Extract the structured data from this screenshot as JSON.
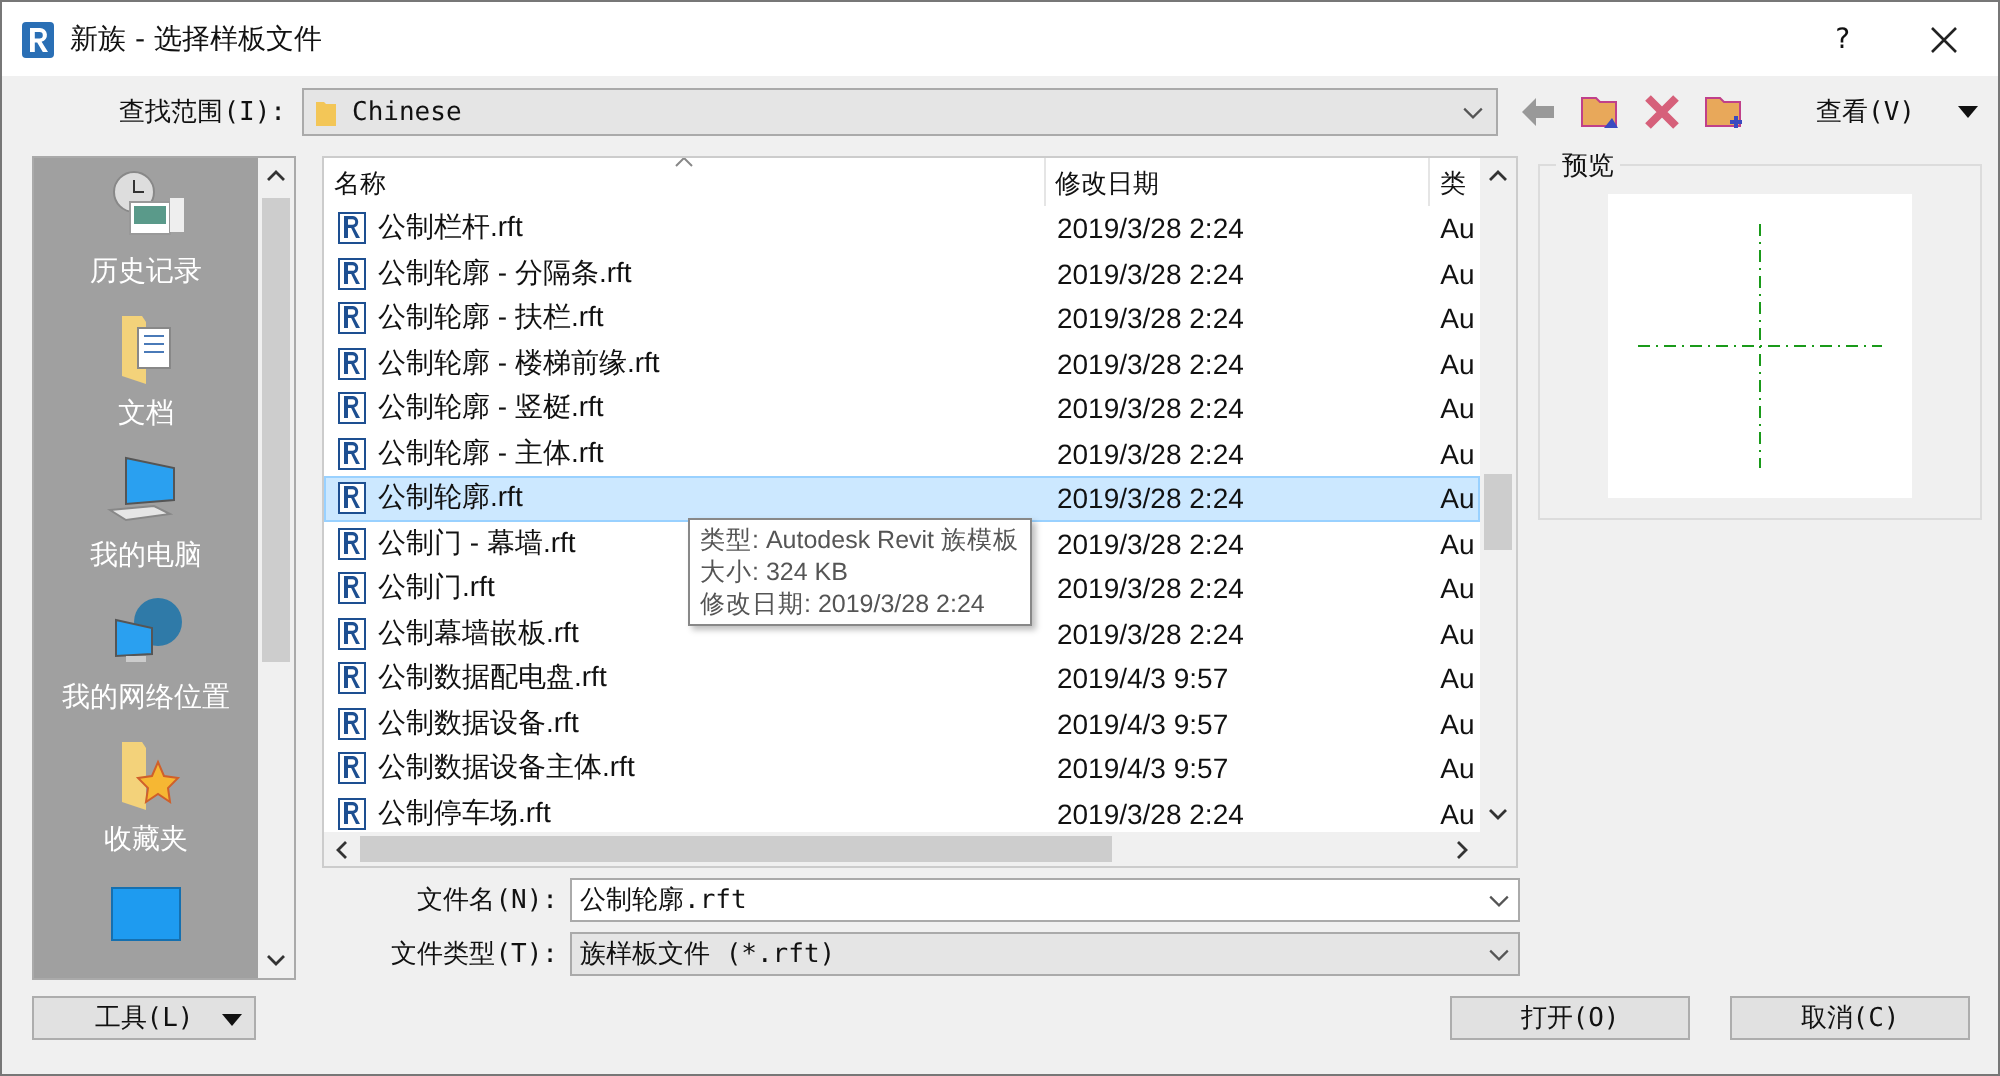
{
  "window": {
    "title": "新族 - 选择样板文件",
    "help": "?"
  },
  "look_in": {
    "label": "查找范围(I):",
    "value": "Chinese"
  },
  "view_menu": {
    "label": "查看(V)"
  },
  "places": [
    {
      "kind": "history",
      "label": "历史记录"
    },
    {
      "kind": "documents",
      "label": "文档"
    },
    {
      "kind": "computer",
      "label": "我的电脑"
    },
    {
      "kind": "network",
      "label": "我的网络位置"
    },
    {
      "kind": "favorites",
      "label": "收藏夹"
    },
    {
      "kind": "desktop"
    }
  ],
  "columns": [
    {
      "label": "名称",
      "sorted": true
    },
    {
      "label": "修改日期",
      "sorted": false
    },
    {
      "label": "类",
      "sorted": false
    }
  ],
  "files": [
    {
      "name": "公制栏杆.rft",
      "date": "2019/3/28 2:24",
      "type": "Au",
      "selected": false
    },
    {
      "name": "公制轮廓 - 分隔条.rft",
      "date": "2019/3/28 2:24",
      "type": "Au",
      "selected": false
    },
    {
      "name": "公制轮廓 - 扶栏.rft",
      "date": "2019/3/28 2:24",
      "type": "Au",
      "selected": false
    },
    {
      "name": "公制轮廓 - 楼梯前缘.rft",
      "date": "2019/3/28 2:24",
      "type": "Au",
      "selected": false
    },
    {
      "name": "公制轮廓 - 竖梃.rft",
      "date": "2019/3/28 2:24",
      "type": "Au",
      "selected": false
    },
    {
      "name": "公制轮廓 - 主体.rft",
      "date": "2019/3/28 2:24",
      "type": "Au",
      "selected": false
    },
    {
      "name": "公制轮廓.rft",
      "date": "2019/3/28 2:24",
      "type": "Au",
      "selected": true
    },
    {
      "name": "公制门 - 幕墙.rft",
      "date": "2019/3/28 2:24",
      "type": "Au",
      "selected": false
    },
    {
      "name": "公制门.rft",
      "date": "2019/3/28 2:24",
      "type": "Au",
      "selected": false
    },
    {
      "name": "公制幕墙嵌板.rft",
      "date": "2019/3/28 2:24",
      "type": "Au",
      "selected": false
    },
    {
      "name": "公制数据配电盘.rft",
      "date": "2019/4/3 9:57",
      "type": "Au",
      "selected": false
    },
    {
      "name": "公制数据设备.rft",
      "date": "2019/4/3 9:57",
      "type": "Au",
      "selected": false
    },
    {
      "name": "公制数据设备主体.rft",
      "date": "2019/4/3 9:57",
      "type": "Au",
      "selected": false
    },
    {
      "name": "公制停车场.rft",
      "date": "2019/3/28 2:24",
      "type": "Au",
      "selected": false
    }
  ],
  "tooltip": {
    "lines": [
      "类型: Autodesk Revit 族模板",
      "大小: 324 KB",
      "修改日期: 2019/3/28 2:24"
    ]
  },
  "preview": {
    "title": "预览"
  },
  "file_name": {
    "label": "文件名(N):",
    "value": "公制轮廓.rft"
  },
  "file_type": {
    "label": "文件类型(T):",
    "value": "族样板文件 (*.rft)"
  },
  "tools_button": {
    "label": "工具(L)"
  },
  "buttons": [
    "打开(O)",
    "取消(C)"
  ]
}
